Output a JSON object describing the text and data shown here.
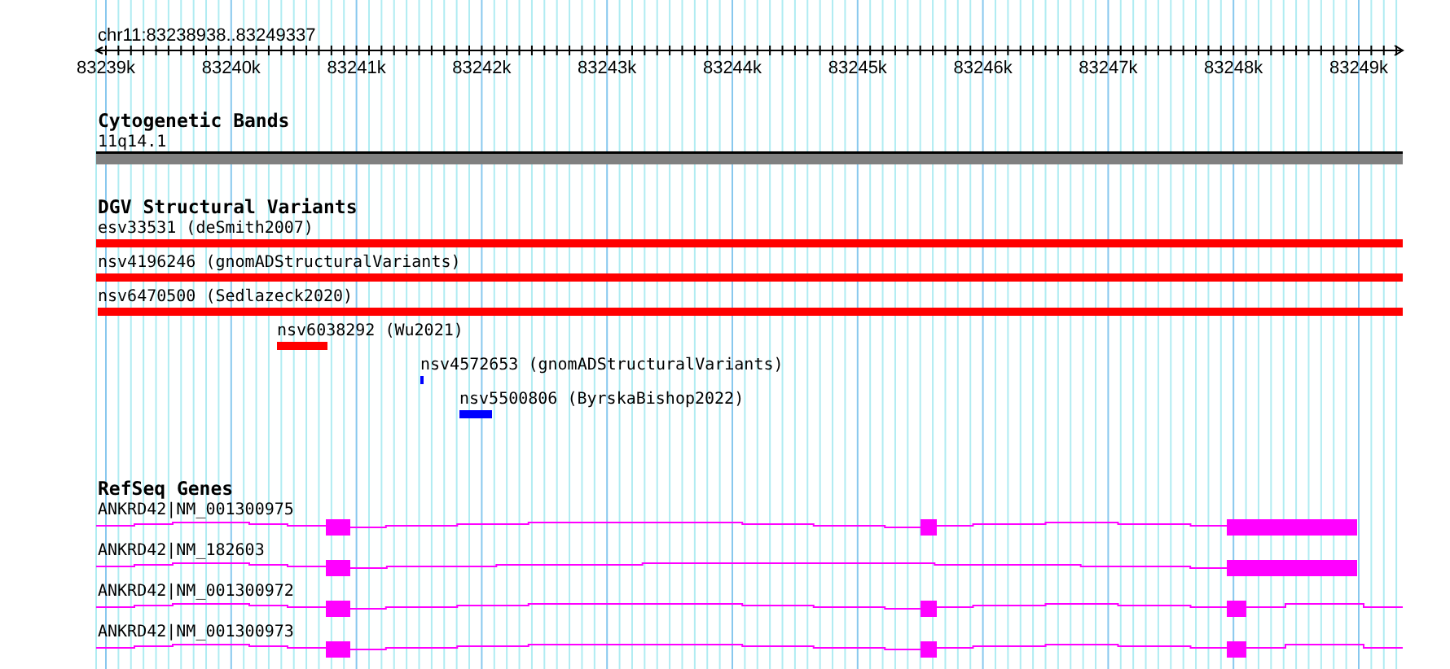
{
  "locus": "chr11:83238938..83249337",
  "axis": {
    "ticks": [
      "83239k",
      "83240k",
      "83241k",
      "83242k",
      "83243k",
      "83244k",
      "83245k",
      "83246k",
      "83247k",
      "83248k",
      "83249k"
    ]
  },
  "tracks": [
    {
      "kind": "bands",
      "title": "Cytogenetic Bands",
      "features": [
        {
          "label": "11q14.1"
        }
      ]
    },
    {
      "kind": "variants",
      "title": "DGV Structural Variants",
      "features": [
        {
          "label": "esv33531 (deSmith2007)",
          "color": "#ff0000"
        },
        {
          "label": "nsv4196246 (gnomADStructuralVariants)",
          "color": "#ff0000"
        },
        {
          "label": "nsv6470500 (Sedlazeck2020)",
          "color": "#ff0000"
        },
        {
          "label": "nsv6038292 (Wu2021)",
          "color": "#ff0000"
        },
        {
          "label": "nsv4572653 (gnomADStructuralVariants)",
          "color": "#0000ff"
        },
        {
          "label": "nsv5500806 (ByrskaBishop2022)",
          "color": "#0000ff"
        }
      ]
    },
    {
      "kind": "genes",
      "title": "RefSeq Genes",
      "features": [
        {
          "label": "ANKRD42|NM_001300975"
        },
        {
          "label": "ANKRD42|NM_182603"
        },
        {
          "label": "ANKRD42|NM_001300972"
        },
        {
          "label": "ANKRD42|NM_001300973"
        }
      ]
    }
  ]
}
